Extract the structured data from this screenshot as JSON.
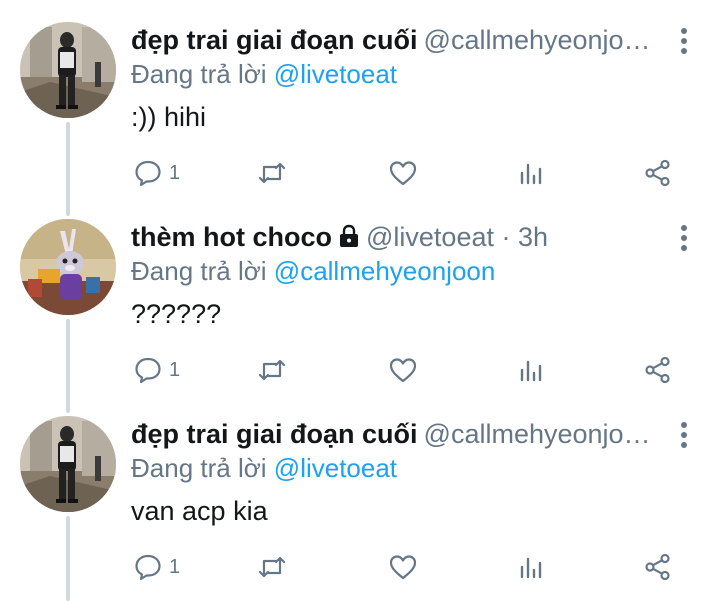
{
  "colors": {
    "text": "#14171a",
    "secondary": "#657786",
    "accent": "#1da1f2",
    "thread_line": "#cfd9de"
  },
  "icons": {
    "reply": "reply-icon",
    "retweet": "retweet-icon",
    "like": "heart-icon",
    "analytics": "analytics-icon",
    "share": "share-icon",
    "more": "more-vertical-icon",
    "lock": "lock-icon"
  },
  "tweets": [
    {
      "name": "đẹp trai giai đoạn cuối",
      "handle": "@callmehyeonjo…",
      "separator": "",
      "time": "",
      "reply_prefix": "Đang trả lời",
      "reply_to": "@livetoeat",
      "text": ":)) hihi",
      "reply_count": "1"
    },
    {
      "name": "thèm hot choco",
      "handle": "@livetoeat",
      "separator": " · ",
      "time": "3h",
      "reply_prefix": "Đang trả lời",
      "reply_to": "@callmehyeonjoon",
      "text": "??????",
      "reply_count": "1"
    },
    {
      "name": "đẹp trai giai đoạn cuối",
      "handle": "@callmehyeonjo…",
      "separator": "",
      "time": "",
      "reply_prefix": "Đang trả lời",
      "reply_to": "@livetoeat",
      "text": "van acp kia",
      "reply_count": "1"
    }
  ]
}
